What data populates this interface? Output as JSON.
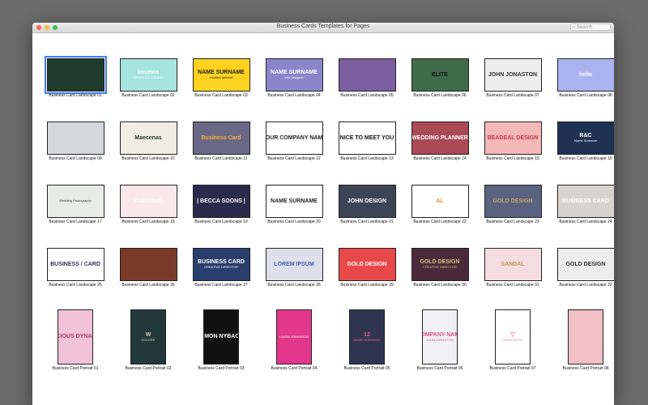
{
  "window": {
    "title": "Business Cards Templates for Pages",
    "search_placeholder": "Search"
  },
  "colors": {
    "selection": "#3b7cf4",
    "close": "#fc605c",
    "minimize": "#fdbc40",
    "zoom": "#34c84a"
  },
  "templates": [
    {
      "label": "Business Card Landscape 01",
      "bg": "#1f3b2d",
      "fg": "#cde8d6",
      "t1": "",
      "t2": "",
      "selected": true
    },
    {
      "label": "Business Card Landscape 02",
      "bg": "#a6e4e0",
      "fg": "#ffffff",
      "t1": "kosmos",
      "t2": "LIFESTYLE GROUP"
    },
    {
      "label": "Business Card Landscape 03",
      "bg": "#ffd21f",
      "fg": "#222222",
      "t1": "NAME SURNAME",
      "t2": "creative director"
    },
    {
      "label": "Business Card Landscape 04",
      "bg": "#8a86c9",
      "fg": "#ffffff",
      "t1": "NAME SURNAME",
      "t2": "web designer"
    },
    {
      "label": "Business Card Landscape 05",
      "bg": "#7b5fa0",
      "fg": "#ffffff",
      "t1": "",
      "t2": ""
    },
    {
      "label": "Business Card Landscape 06",
      "bg": "#3f6b4a",
      "fg": "#111111",
      "t1": "ELITE",
      "t2": ""
    },
    {
      "label": "Business Card Landscape 07",
      "bg": "#ededed",
      "fg": "#333333",
      "t1": "JOHN JONASTON",
      "t2": ""
    },
    {
      "label": "Business Card Landscape 08",
      "bg": "#aab3f0",
      "fg": "#ffffff",
      "t1": "hello",
      "t2": ""
    },
    {
      "label": "Business Card Landscape 09",
      "bg": "#d4d8dc",
      "fg": "#333333",
      "t1": "",
      "t2": ""
    },
    {
      "label": "Business Card Landscape 10",
      "bg": "#f2ede4",
      "fg": "#1e3a2a",
      "t1": "Maecenas",
      "t2": ""
    },
    {
      "label": "Business Card Landscape 11",
      "bg": "#6a6787",
      "fg": "#f5b63a",
      "t1": "Business Card",
      "t2": ""
    },
    {
      "label": "Business Card Landscape 12",
      "bg": "#ffffff",
      "fg": "#222222",
      "t1": "YOUR COMPANY NAME",
      "t2": ""
    },
    {
      "label": "Business Card Landscape 13",
      "bg": "#ffffff",
      "fg": "#111111",
      "t1": "NICE TO MEET YOU",
      "t2": ""
    },
    {
      "label": "Business Card Landscape 14",
      "bg": "#a94a55",
      "fg": "#ffffff",
      "t1": "WEDDING PLANNER",
      "t2": ""
    },
    {
      "label": "Business Card Landscape 15",
      "bg": "#f4b8b8",
      "fg": "#c0394b",
      "t1": "BEADEAL DESIGN",
      "t2": ""
    },
    {
      "label": "Business Card Landscape 16",
      "bg": "#1f3153",
      "fg": "#ffffff",
      "t1": "R&C",
      "t2": "Name Surname"
    },
    {
      "label": "Business Card Landscape 17",
      "bg": "#e8ebe6",
      "fg": "#333333",
      "t1": "",
      "t2": "Wedding Photography"
    },
    {
      "label": "Business Card Landscape 18",
      "bg": "#fbe8ec",
      "fg": "#ffffff",
      "t1": "CUPCAKE",
      "t2": ""
    },
    {
      "label": "Business Card Landscape 19",
      "bg": "#2a2a4a",
      "fg": "#ffffff",
      "t1": "| BECCA SOONS |",
      "t2": ""
    },
    {
      "label": "Business Card Landscape 20",
      "bg": "#ffffff",
      "fg": "#222222",
      "t1": "NAME SURNAME",
      "t2": ""
    },
    {
      "label": "Business Card Landscape 21",
      "bg": "#3d4455",
      "fg": "#ffffff",
      "t1": "JOHN DESIGN",
      "t2": ""
    },
    {
      "label": "Business Card Landscape 22",
      "bg": "#ffffff",
      "fg": "#c9a13b",
      "t1": "AL",
      "t2": ""
    },
    {
      "label": "Business Card Landscape 23",
      "bg": "#59627f",
      "fg": "#c9a66b",
      "t1": "GOLD DESIGN",
      "t2": ""
    },
    {
      "label": "Business Card Landscape 24",
      "bg": "#d8d3cc",
      "fg": "#ffffff",
      "t1": "BUSINESS CARD",
      "t2": ""
    },
    {
      "label": "Business Card Landscape 25",
      "bg": "#ffffff",
      "fg": "#2a3550",
      "t1": "BUSINESS / CARD",
      "t2": ""
    },
    {
      "label": "Business Card Landscape 26",
      "bg": "#7a3a2a",
      "fg": "#ffffff",
      "t1": "",
      "t2": ""
    },
    {
      "label": "Business Card Landscape 27",
      "bg": "#2a3e6e",
      "fg": "#ffffff",
      "t1": "BUSINESS CARD",
      "t2": "CREATIVE DIRECTOR"
    },
    {
      "label": "Business Card Landscape 28",
      "bg": "#dedfea",
      "fg": "#3a5fb0",
      "t1": "LOREM IPSUM",
      "t2": ""
    },
    {
      "label": "Business Card Landscape 29",
      "bg": "#e9484a",
      "fg": "#ffffff",
      "t1": "GOLD DESIGN",
      "t2": ""
    },
    {
      "label": "Business Card Landscape 30",
      "bg": "#4a2a3a",
      "fg": "#e0c07a",
      "t1": "GOLD DESIGN",
      "t2": "CREATIVE DIRECTOR"
    },
    {
      "label": "Business Card Landscape 31",
      "bg": "#f6dde2",
      "fg": "#b39a5a",
      "t1": "SANDAL",
      "t2": ""
    },
    {
      "label": "Business Card Landscape 32",
      "bg": "#ededed",
      "fg": "#333333",
      "t1": "GOLD DESIGN",
      "t2": ""
    }
  ],
  "portraits": [
    {
      "label": "Business Card Portrait 01",
      "bg": "#f2c3d8",
      "fg": "#b0386e",
      "t1": "PRECIOUS DYNAMIKS",
      "t2": ""
    },
    {
      "label": "Business Card Portrait 02",
      "bg": "#22383a",
      "fg": "#d9d0b5",
      "t1": "W",
      "t2": "DOLORE"
    },
    {
      "label": "Business Card Portrait 03",
      "bg": "#111111",
      "fg": "#ffffff",
      "t1": "SIMON NYBACK",
      "t2": ""
    },
    {
      "label": "Business Card Portrait 04",
      "bg": "#e2378a",
      "fg": "#ffffff",
      "t1": "",
      "t2": "LAURA JOHANSON"
    },
    {
      "label": "Business Card Portrait 05",
      "bg": "#2f3550",
      "fg": "#e65a88",
      "t1": "12",
      "t2": "NAME SURNAME"
    },
    {
      "label": "Business Card Portrait 06",
      "bg": "#f1f1f5",
      "fg": "#d9508c",
      "t1": "COMPANY NAME",
      "t2": "JOHN JONASTON"
    },
    {
      "label": "Business Card Portrait 07",
      "bg": "#ffffff",
      "fg": "#e97a8a",
      "t1": "▽",
      "t2": "JOHN SMITH"
    },
    {
      "label": "Business Card Portrait 08",
      "bg": "#f1c0c6",
      "fg": "#ffffff",
      "t1": "",
      "t2": ""
    }
  ]
}
